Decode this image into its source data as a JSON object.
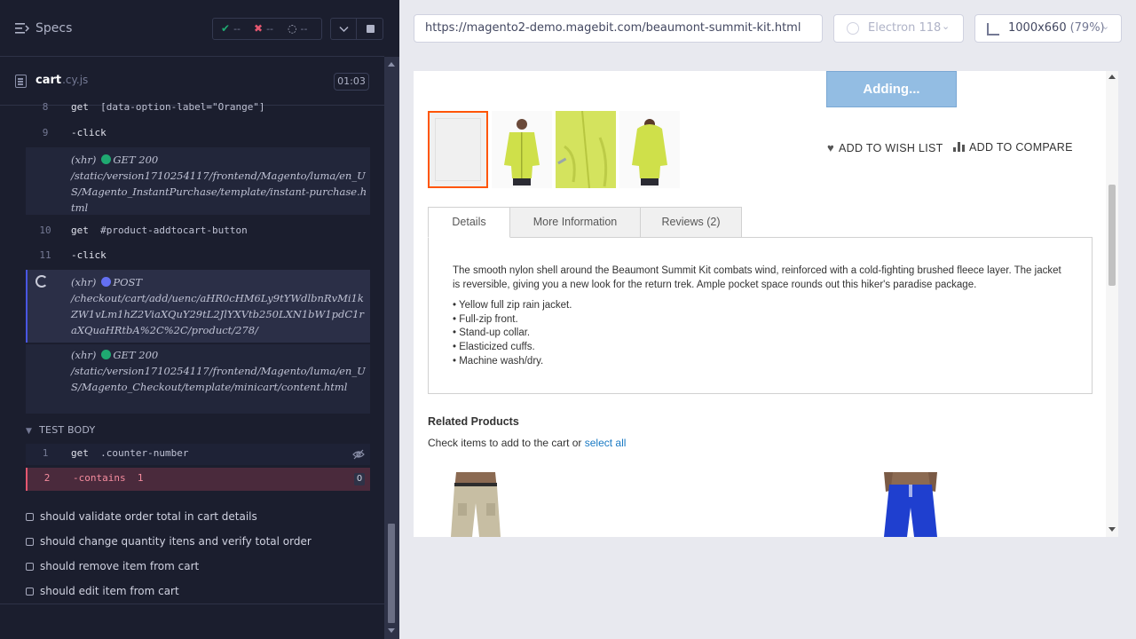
{
  "specs": {
    "title": "Specs",
    "passed": "--",
    "failed": "--",
    "pending": "--"
  },
  "file": {
    "name": "cart",
    "ext": ".cy.js",
    "duration": "01:03"
  },
  "commands": [
    {
      "num": "8",
      "name": "get",
      "arg": "[data-option-label=\"Orange\"]"
    },
    {
      "num": "9",
      "name": "-click",
      "arg": ""
    },
    {
      "num": "10",
      "name": "get",
      "arg": "#product-addtocart-button"
    },
    {
      "num": "11",
      "name": "-click",
      "arg": ""
    }
  ],
  "xhr": [
    {
      "label": "(xhr)",
      "method": "GET 200",
      "url": "/static/version1710254117/frontend/Magento/luma/en_US/Magento_InstantPurchase/template/instant-purchase.html"
    },
    {
      "label": "(xhr)",
      "method": "POST",
      "url": "/checkout/cart/add/uenc/aHR0cHM6Ly9tYWdlbnRvMi1kZW1vLm1hZ2ViaXQuY29tL2JlYXVtb250LXN1bW1pdC1raXQuaHRtbA%2C%2C/product/278/"
    },
    {
      "label": "(xhr)",
      "method": "GET 200",
      "url": "/static/version1710254117/frontend/Magento/luma/en_US/Magento_Checkout/template/minicart/content.html"
    }
  ],
  "test_body": {
    "header": "TEST BODY",
    "rows": [
      {
        "num": "1",
        "name": "get",
        "arg": ".counter-number"
      },
      {
        "num": "2",
        "name": "-contains",
        "arg": "1",
        "badge": "0"
      }
    ]
  },
  "tests": [
    "should validate order total in cart details",
    "should change quantity itens and verify total order",
    "should remove item from cart",
    "should edit item from cart"
  ],
  "browser_bar": {
    "url": "https://magento2-demo.magebit.com/beaumont-summit-kit.html",
    "browser": "Electron 118",
    "viewport": "1000x660",
    "zoom": "(79%)"
  },
  "product": {
    "adding_label": "Adding...",
    "wishlist": "ADD TO WISH LIST",
    "compare": "ADD TO COMPARE",
    "tabs": [
      "Details",
      "More Information",
      "Reviews (2)"
    ],
    "description": "The smooth nylon shell around the Beaumont Summit Kit combats wind, reinforced with a cold-fighting brushed fleece layer. The jacket is reversible, giving you a new look for the return trek. Ample pocket space rounds out this hiker's paradise package.",
    "bullets": [
      "• Yellow full zip rain jacket.",
      "• Full-zip front.",
      "• Stand-up collar.",
      "• Elasticized cuffs.",
      "• Machine wash/dry."
    ],
    "related_title": "Related Products",
    "related_text": "Check items to add to the cart or ",
    "related_link": "select all"
  },
  "colors": {
    "pass": "#1fa971",
    "fail": "#e45770",
    "get_dot": "#1fa971",
    "post_dot": "#6470f3",
    "accent": "#ff5501"
  }
}
